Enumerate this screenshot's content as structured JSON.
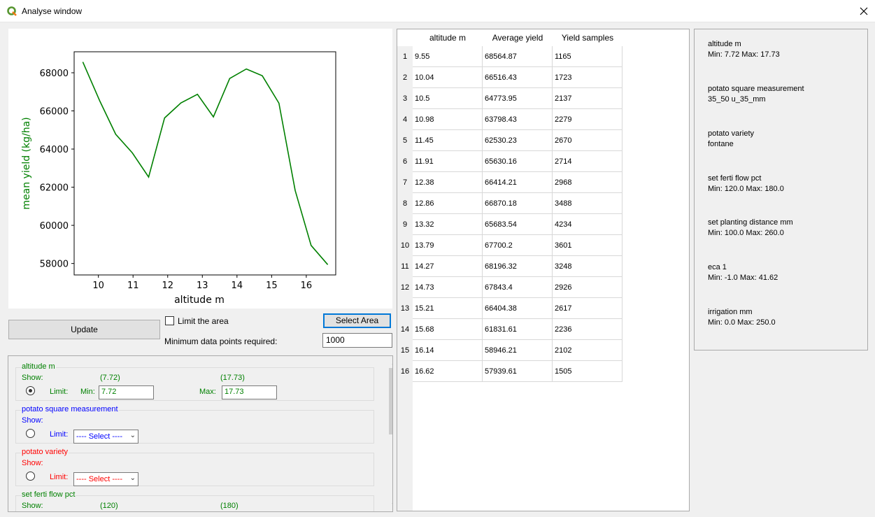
{
  "window": {
    "title": "Analyse window"
  },
  "chart_data": {
    "type": "line",
    "title": "",
    "xlabel": "altitude  m",
    "ylabel": "mean yield (kg/ha)",
    "x": [
      9.55,
      10.04,
      10.5,
      10.98,
      11.45,
      11.91,
      12.38,
      12.86,
      13.32,
      13.79,
      14.27,
      14.73,
      15.21,
      15.68,
      16.14,
      16.62
    ],
    "series": [
      {
        "values": [
          68564.87,
          66516.43,
          64773.95,
          63798.43,
          62530.23,
          65630.16,
          66414.21,
          66870.18,
          65683.54,
          67700.2,
          68196.32,
          67843.4,
          66404.38,
          61831.61,
          58946.21,
          57939.61
        ],
        "color": "#008000"
      }
    ],
    "xticks": [
      "10",
      "11",
      "12",
      "13",
      "14",
      "15",
      "16"
    ],
    "yticks": [
      "58000",
      "60000",
      "62000",
      "64000",
      "66000",
      "68000"
    ],
    "xlim": [
      9.3,
      16.85
    ],
    "ylim": [
      57400,
      69100
    ],
    "grid": false,
    "label_color": "#008000"
  },
  "controls": {
    "update_label": "Update",
    "limit_area_label": "Limit the area",
    "limit_area_checked": false,
    "select_area_label": "Select Area",
    "min_points_label": "Minimum data points required:",
    "min_points_value": "1000"
  },
  "groups": [
    {
      "title": "altitude  m",
      "color": "green",
      "show_label": "Show:",
      "show_min": "(7.72)",
      "show_max": "(17.73)",
      "limit_label": "Limit:",
      "min_label": "Min:",
      "max_label": "Max:",
      "min_value": "7.72",
      "max_value": "17.73",
      "selected": true
    },
    {
      "title": "potato square measurement",
      "color": "blue",
      "show_label": "Show:",
      "limit_label": "Limit:",
      "select_text": "---- Select ----",
      "selected": false
    },
    {
      "title": "potato variety",
      "color": "red",
      "show_label": "Show:",
      "limit_label": "Limit:",
      "select_text": "---- Select ----",
      "selected": false
    },
    {
      "title": "set ferti flow pct",
      "color": "green",
      "show_label": "Show:",
      "show_min": "(120)",
      "show_max": "(180)"
    }
  ],
  "table": {
    "headers": [
      "altitude  m",
      "Average yield",
      "Yield samples"
    ],
    "rows": [
      {
        "n": "1",
        "alt": "9.55",
        "avg": "68564.87",
        "samples": "1165"
      },
      {
        "n": "2",
        "alt": "10.04",
        "avg": "66516.43",
        "samples": "1723"
      },
      {
        "n": "3",
        "alt": "10.5",
        "avg": "64773.95",
        "samples": "2137"
      },
      {
        "n": "4",
        "alt": "10.98",
        "avg": "63798.43",
        "samples": "2279"
      },
      {
        "n": "5",
        "alt": "11.45",
        "avg": "62530.23",
        "samples": "2670"
      },
      {
        "n": "6",
        "alt": "11.91",
        "avg": "65630.16",
        "samples": "2714"
      },
      {
        "n": "7",
        "alt": "12.38",
        "avg": "66414.21",
        "samples": "2968"
      },
      {
        "n": "8",
        "alt": "12.86",
        "avg": "66870.18",
        "samples": "3488"
      },
      {
        "n": "9",
        "alt": "13.32",
        "avg": "65683.54",
        "samples": "4234"
      },
      {
        "n": "10",
        "alt": "13.79",
        "avg": "67700.2",
        "samples": "3601"
      },
      {
        "n": "11",
        "alt": "14.27",
        "avg": "68196.32",
        "samples": "3248"
      },
      {
        "n": "12",
        "alt": "14.73",
        "avg": "67843.4",
        "samples": "2926"
      },
      {
        "n": "13",
        "alt": "15.21",
        "avg": "66404.38",
        "samples": "2617"
      },
      {
        "n": "14",
        "alt": "15.68",
        "avg": "61831.61",
        "samples": "2236"
      },
      {
        "n": "15",
        "alt": "16.14",
        "avg": "58946.21",
        "samples": "2102"
      },
      {
        "n": "16",
        "alt": "16.62",
        "avg": "57939.61",
        "samples": "1505"
      }
    ]
  },
  "info": [
    {
      "name": "altitude  m",
      "detail": "Min: 7.72 Max: 17.73"
    },
    {
      "name": "potato square measurement",
      "detail": "35_50 u_35_mm"
    },
    {
      "name": "potato variety",
      "detail": "fontane"
    },
    {
      "name": "set ferti flow pct",
      "detail": "Min: 120.0 Max: 180.0"
    },
    {
      "name": "set planting distance  mm",
      "detail": "Min: 100.0 Max: 260.0"
    },
    {
      "name": "eca 1",
      "detail": "Min: -1.0 Max: 41.62"
    },
    {
      "name": "irrigation mm",
      "detail": "Min: 0.0 Max: 250.0"
    }
  ],
  "icons": {
    "app": "qgis-logo-icon",
    "close": "close-icon"
  }
}
